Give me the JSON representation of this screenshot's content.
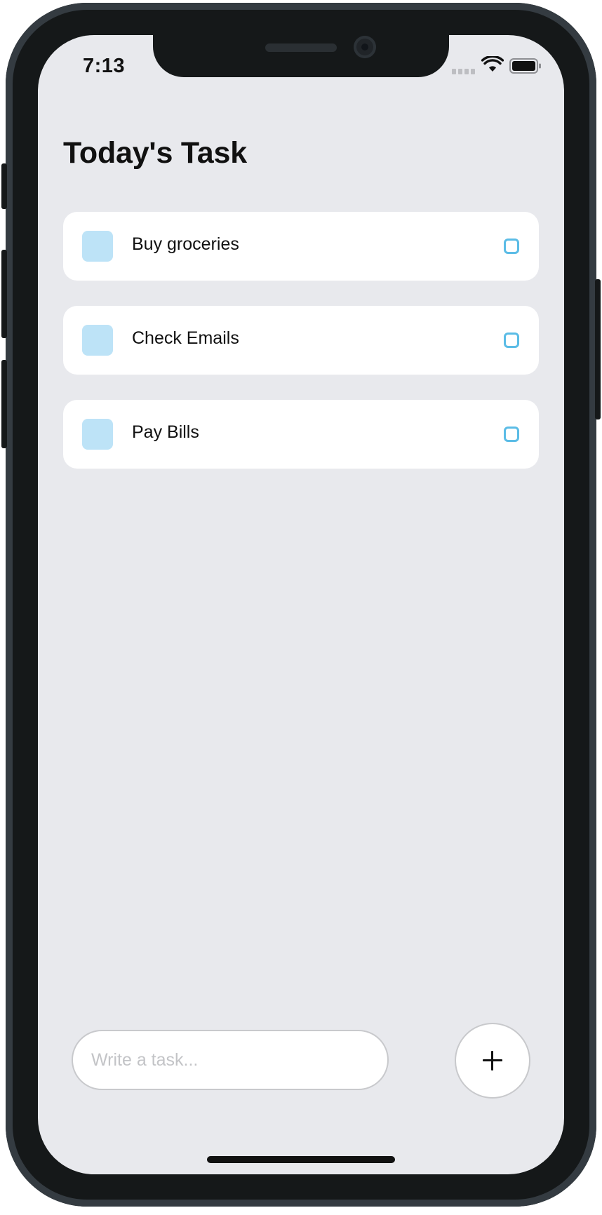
{
  "status_bar": {
    "time": "7:13",
    "icons": [
      "cellular-signal-icon",
      "wifi-icon",
      "battery-icon"
    ]
  },
  "header": {
    "title": "Today's Task"
  },
  "tasks": [
    {
      "label": "Buy groceries"
    },
    {
      "label": "Check Emails"
    },
    {
      "label": "Pay Bills"
    }
  ],
  "composer": {
    "input_value": "",
    "placeholder": "Write a task...",
    "add_button_icon": "plus-icon"
  },
  "colors": {
    "screen_background": "#e8e9ed",
    "card_background": "#ffffff",
    "task_square": "#bde3f7",
    "task_checkbox_border": "#5bbce6",
    "text": "#111111",
    "placeholder": "#c3c4c7"
  }
}
